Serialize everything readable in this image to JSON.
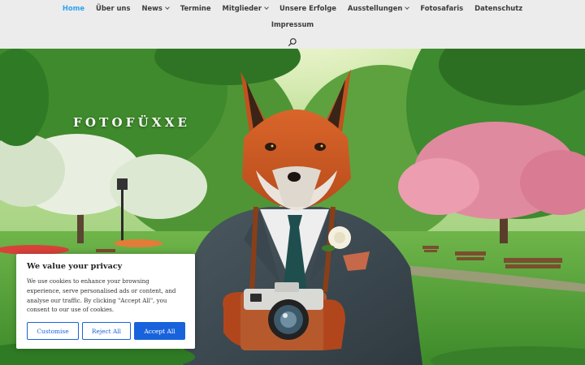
{
  "nav": {
    "items": [
      {
        "label": "Home",
        "active": true,
        "dropdown": false
      },
      {
        "label": "Über uns",
        "active": false,
        "dropdown": false
      },
      {
        "label": "News",
        "active": false,
        "dropdown": true
      },
      {
        "label": "Termine",
        "active": false,
        "dropdown": false
      },
      {
        "label": "Mitglieder",
        "active": false,
        "dropdown": true
      },
      {
        "label": "Unsere Erfolge",
        "active": false,
        "dropdown": false
      },
      {
        "label": "Ausstellungen",
        "active": false,
        "dropdown": true
      },
      {
        "label": "Fotosafaris",
        "active": false,
        "dropdown": false
      },
      {
        "label": "Datenschutz",
        "active": false,
        "dropdown": false
      }
    ],
    "second_row": [
      {
        "label": "Impressum",
        "active": false,
        "dropdown": false
      }
    ],
    "search_icon": "search-icon",
    "active_color": "#2ea3f2"
  },
  "hero": {
    "site_name": "FOTOFÜXXE",
    "image_subject": "fox-in-suit-with-camera"
  },
  "cookie_banner": {
    "title": "We value your privacy",
    "text": "We use cookies to enhance your browsing experience, serve personalised ads or content, and analyse our traffic. By clicking \"Accept All\", you consent to our use of cookies.",
    "buttons": {
      "customise": "Customise",
      "reject": "Reject All",
      "accept": "Accept All"
    },
    "button_color": "#1863dc"
  }
}
